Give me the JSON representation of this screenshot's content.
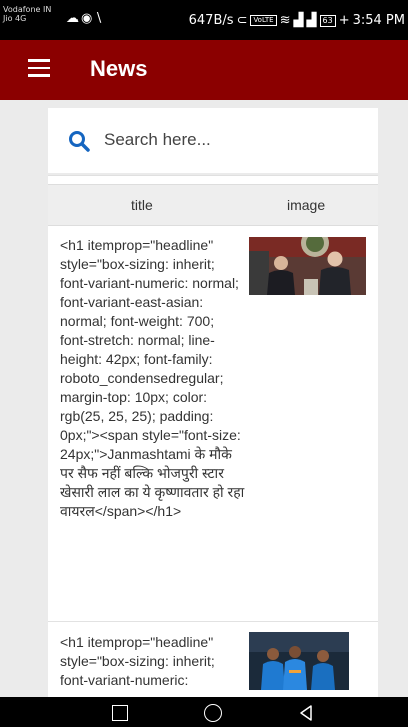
{
  "status_bar": {
    "carrier": "Vodafone IN",
    "network": "Jio 4G",
    "speed": "647B/s",
    "battery": "63",
    "time": "3:54 PM"
  },
  "app_bar": {
    "title": "News",
    "menu_icon": "hamburger-menu-icon"
  },
  "search": {
    "placeholder": "Search here...",
    "icon": "search-icon",
    "accent_color": "#1565c0"
  },
  "table": {
    "columns": [
      "title",
      "image"
    ],
    "rows": [
      {
        "title": "<h1 itemprop=\"headline\" style=\"box-sizing: inherit; font-variant-numeric: normal; font-variant-east-asian: normal; font-weight: 700; font-stretch: normal; line-height: 42px; font-family: roboto_condensedregular; margin-top: 10px; color: rgb(25, 25, 25); padding: 0px;\"><span style=\"font-size: 24px;\">Janmashtami के मौके पर सैफ नहीं बल्कि भोजपुरी स्टार खेसारी लाल का ये कृष्णावतार हो रहा वायरल</span></h1>",
        "image": "two-men-at-podium-photo"
      },
      {
        "title": "<h1 itemprop=\"headline\" style=\"box-sizing: inherit; font-variant-numeric:",
        "image": "cricket-players-photo"
      }
    ]
  },
  "colors": {
    "app_bar": "#8b0000",
    "background": "#ebebeb"
  }
}
